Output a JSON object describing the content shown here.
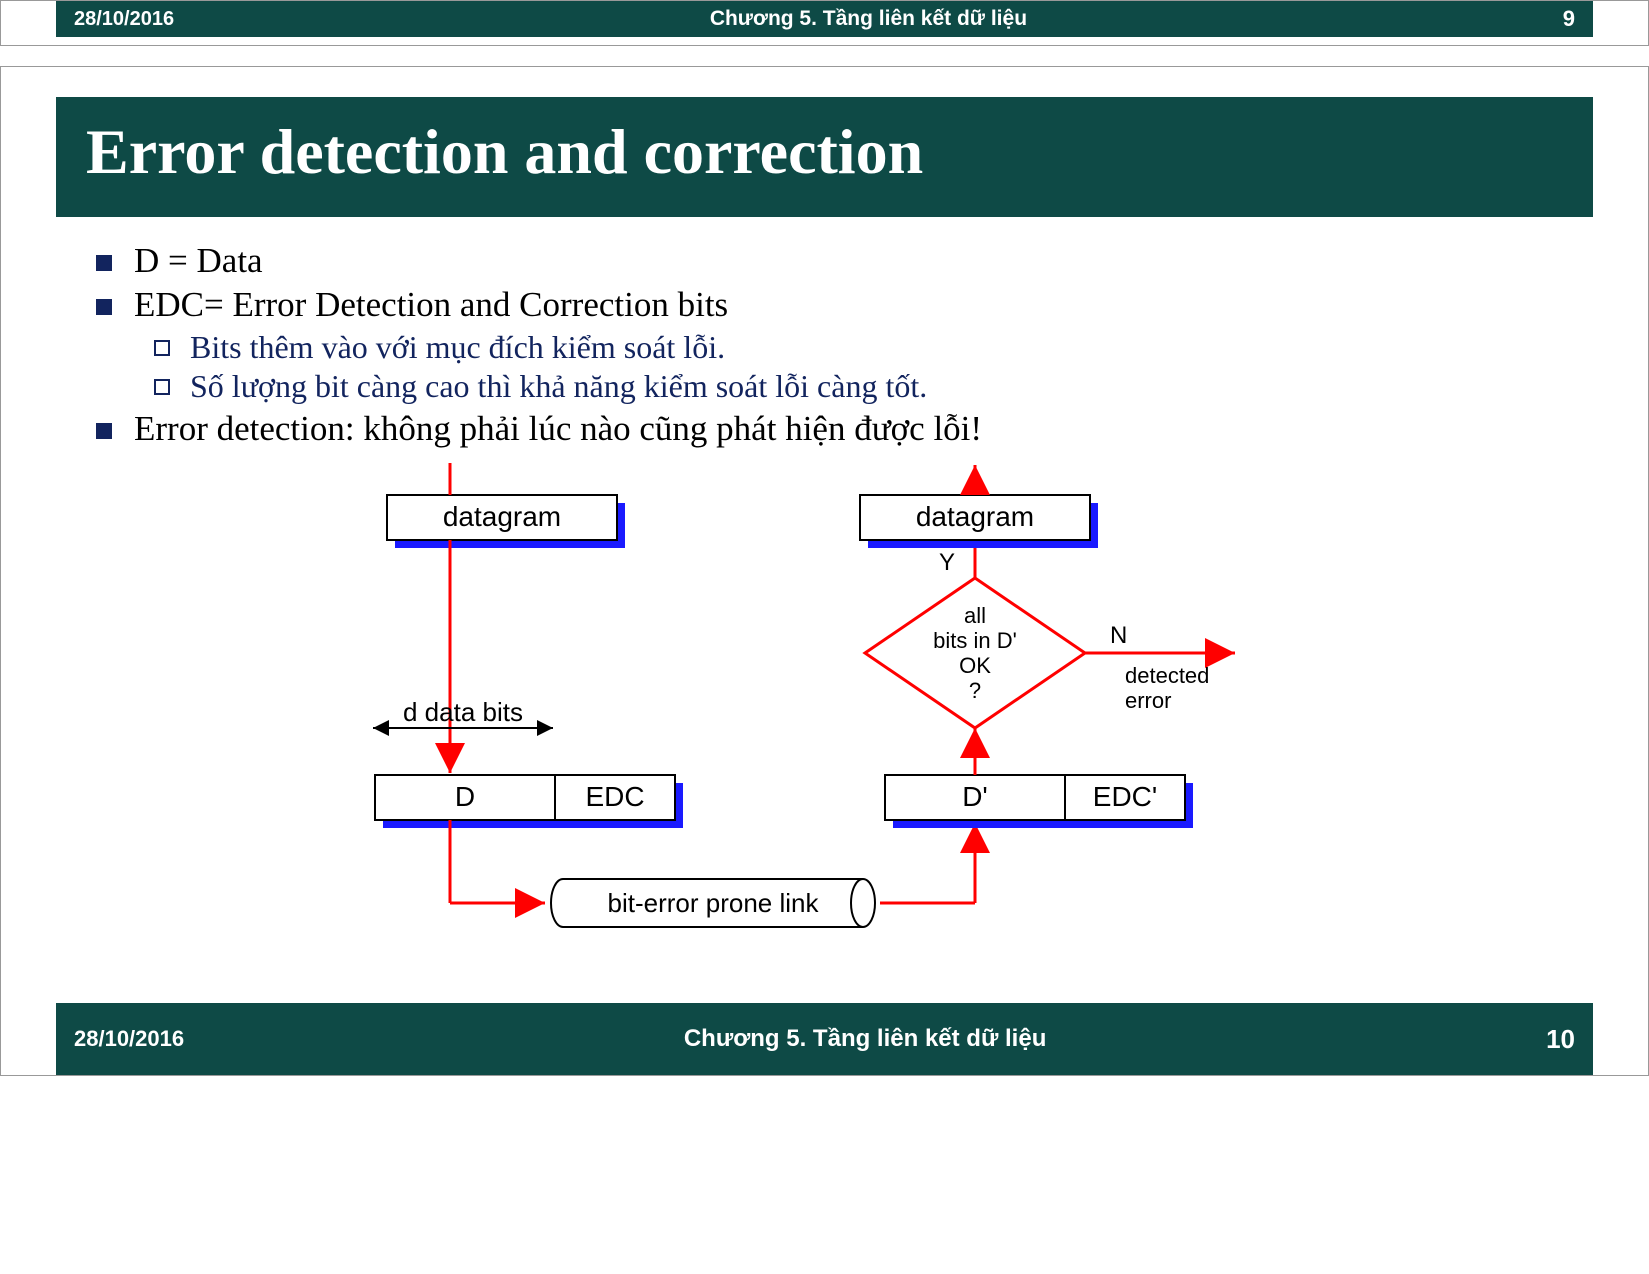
{
  "prev_slide_footer": {
    "date": "28/10/2016",
    "chapter": "Chương 5. Tầng liên kết dữ liệu",
    "page": "9"
  },
  "slide": {
    "title": "Error detection and correction",
    "bullets": {
      "b1": "D = Data",
      "b2": "EDC= Error Detection and Correction bits",
      "b2a": "Bits thêm vào với mục đích kiểm soát lỗi.",
      "b2b": "Số lượng bit càng cao thì khả năng kiểm soát lỗi càng tốt.",
      "b3": "Error detection: không phải lúc nào cũng phát hiện được lỗi!"
    },
    "diagram": {
      "datagram_left": "datagram",
      "datagram_right": "datagram",
      "d_data_bits": "d data bits",
      "D": "D",
      "EDC": "EDC",
      "Dp": "D'",
      "EDCp": "EDC'",
      "bit_error_link": "bit-error prone link",
      "Y": "Y",
      "N": "N",
      "check_l1": "all",
      "check_l2": "bits in D'",
      "check_l3": "OK",
      "check_l4": "?",
      "detected": "detected",
      "error": "error"
    },
    "footer": {
      "date": "28/10/2016",
      "chapter": "Chương 5. Tầng liên kết dữ liệu",
      "page": "10"
    }
  }
}
